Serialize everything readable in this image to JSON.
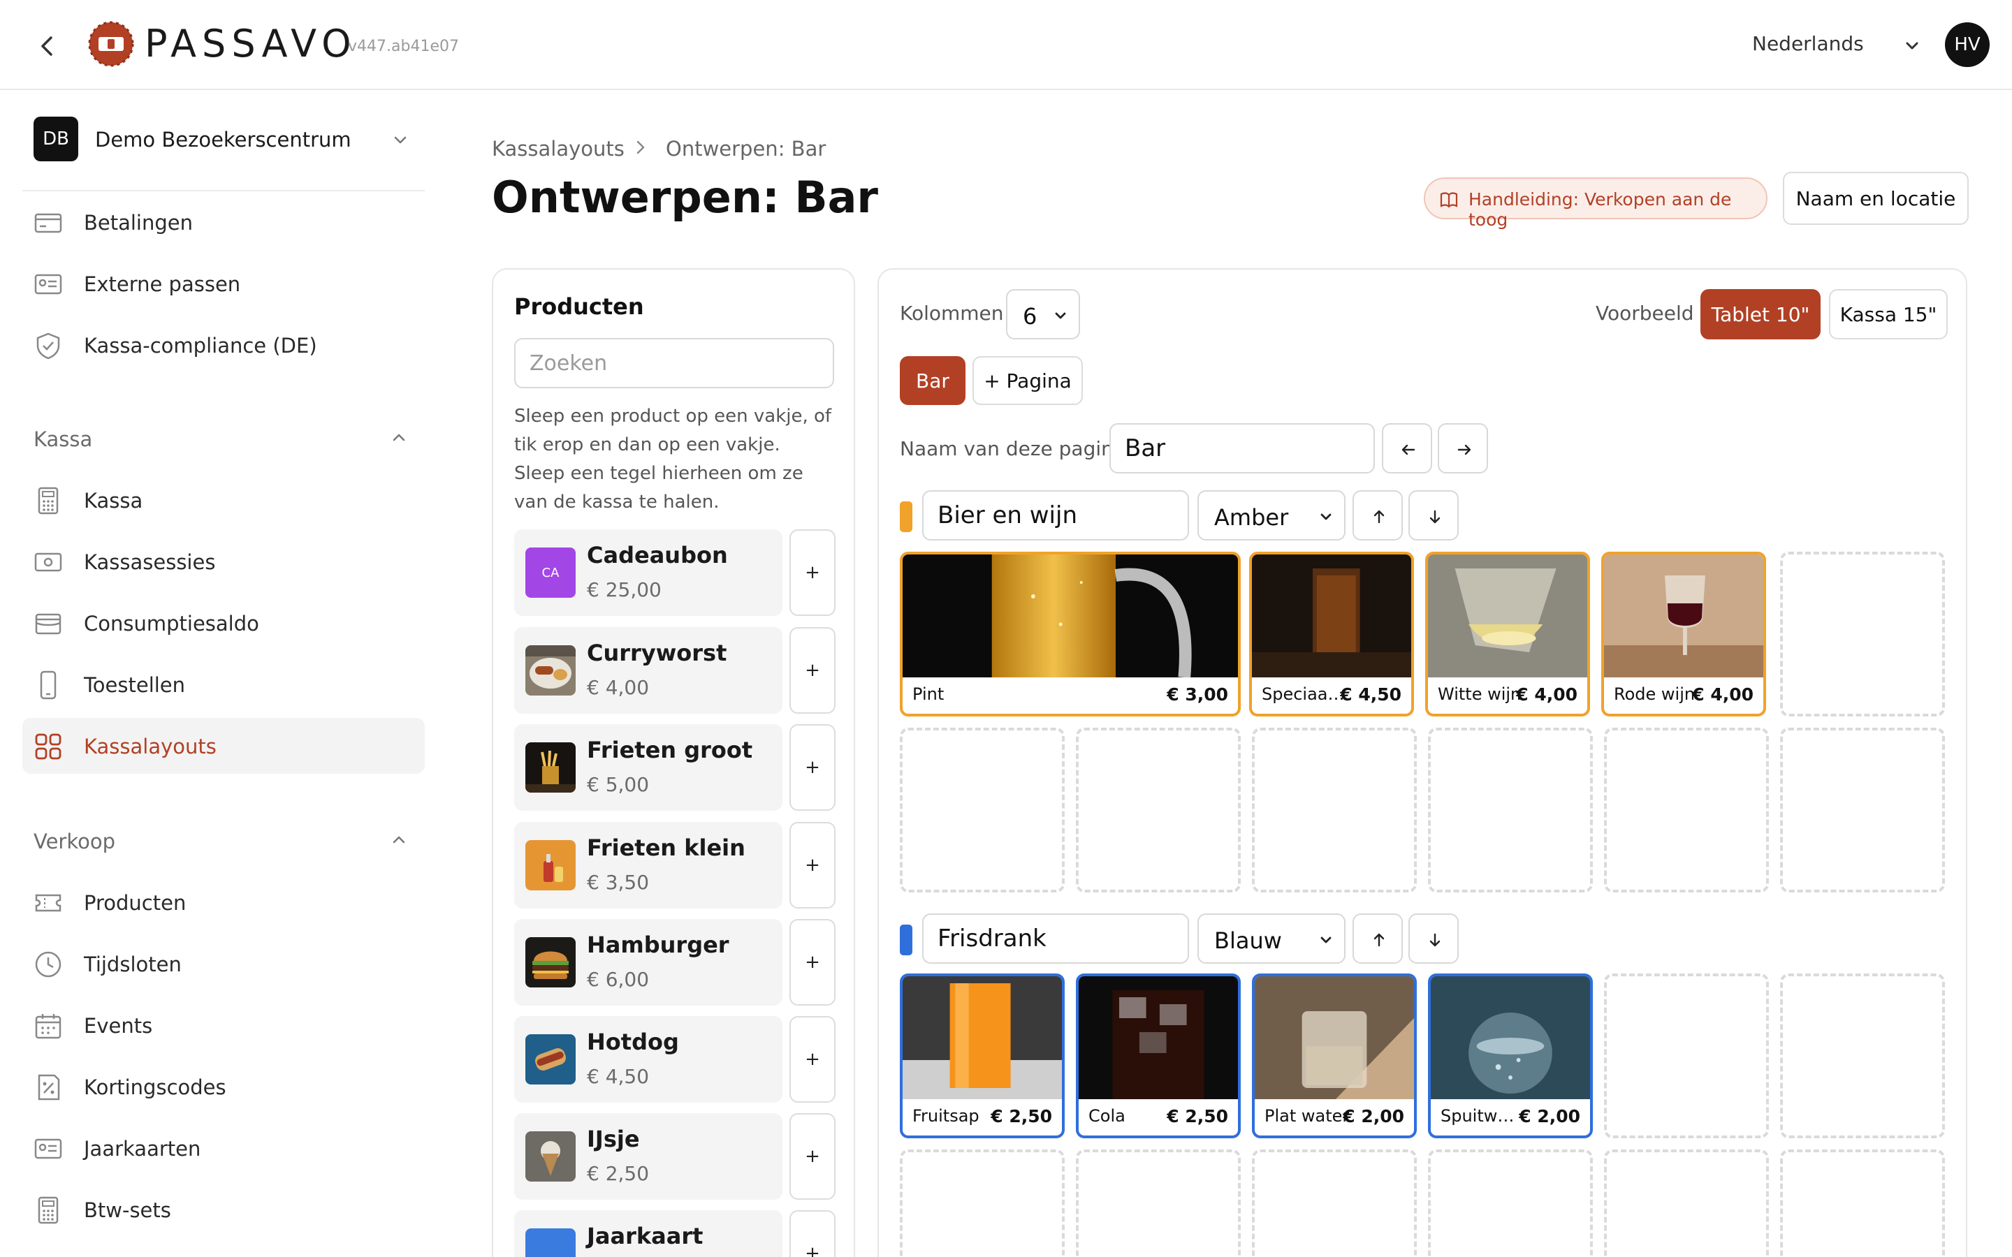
{
  "header": {
    "brand": "PASSAVO",
    "version": "v447.ab41e07",
    "language": "Nederlands",
    "user_initials": "HV"
  },
  "sidebar": {
    "org_initials": "DB",
    "org_name": "Demo Bezoekerscentrum",
    "top_items": [
      {
        "label": "Betalingen",
        "icon": "credit-card-icon"
      },
      {
        "label": "Externe passen",
        "icon": "id-card-icon"
      },
      {
        "label": "Kassa-compliance (DE)",
        "icon": "shield-check-icon"
      }
    ],
    "kassa": {
      "title": "Kassa",
      "items": [
        {
          "label": "Kassa",
          "icon": "calculator-icon"
        },
        {
          "label": "Kassasessies",
          "icon": "cash-icon"
        },
        {
          "label": "Consumptiesaldo",
          "icon": "wallet-icon"
        },
        {
          "label": "Toestellen",
          "icon": "phone-icon"
        },
        {
          "label": "Kassalayouts",
          "icon": "grid-icon",
          "active": true
        }
      ]
    },
    "verkoop": {
      "title": "Verkoop",
      "items": [
        {
          "label": "Producten",
          "icon": "ticket-icon"
        },
        {
          "label": "Tijdsloten",
          "icon": "clock-icon"
        },
        {
          "label": "Events",
          "icon": "calendar-icon"
        },
        {
          "label": "Kortingscodes",
          "icon": "percent-icon"
        },
        {
          "label": "Jaarkaarten",
          "icon": "id-card-icon"
        },
        {
          "label": "Btw-sets",
          "icon": "calculator-icon"
        }
      ]
    }
  },
  "breadcrumb": {
    "parent": "Kassalayouts",
    "current": "Ontwerpen: Bar"
  },
  "page": {
    "title": "Ontwerpen: Bar",
    "guide_label": "Handleiding: Verkopen aan de toog",
    "name_location_label": "Naam en locatie"
  },
  "products_panel": {
    "title": "Producten",
    "search_placeholder": "Zoeken",
    "help_text": "Sleep een product op een vakje, of tik erop en dan op een vakje. Sleep een tegel hierheen om ze van de kassa te halen.",
    "add_label": "+",
    "products": [
      {
        "name": "Cadeaubon",
        "price": "€ 25,00",
        "thumb": "CA"
      },
      {
        "name": "Curryworst",
        "price": "€ 4,00",
        "thumb": ""
      },
      {
        "name": "Frieten groot",
        "price": "€ 5,00",
        "thumb": ""
      },
      {
        "name": "Frieten klein",
        "price": "€ 3,50",
        "thumb": ""
      },
      {
        "name": "Hamburger",
        "price": "€ 6,00",
        "thumb": ""
      },
      {
        "name": "Hotdog",
        "price": "€ 4,50",
        "thumb": ""
      },
      {
        "name": "IJsje",
        "price": "€ 2,50",
        "thumb": ""
      },
      {
        "name": "Jaarkaart",
        "price": "",
        "thumb": "JA"
      }
    ]
  },
  "layout": {
    "columns_label": "Kolommen",
    "columns_value": "6",
    "preview_label": "Voorbeeld",
    "preview_options": [
      "Tablet 10\"",
      "Kassa 15\""
    ],
    "pages": [
      "Bar"
    ],
    "add_page_label": "+ Pagina",
    "page_name_label": "Naam van deze pagina",
    "page_name_value": "Bar",
    "groups": [
      {
        "name": "Bier en wijn",
        "color_name": "Amber",
        "color": "#f0a22a",
        "tiles": [
          {
            "name": "Pint",
            "price": "€ 3,00"
          },
          {
            "name": "Speciaa…",
            "price": "€ 4,50"
          },
          {
            "name": "Witte wijn",
            "price": "€ 4,00"
          },
          {
            "name": "Rode wijn",
            "price": "€ 4,00"
          }
        ]
      },
      {
        "name": "Frisdrank",
        "color_name": "Blauw",
        "color": "#2f6fdc",
        "tiles": [
          {
            "name": "Fruitsap",
            "price": "€ 2,50"
          },
          {
            "name": "Cola",
            "price": "€ 2,50"
          },
          {
            "name": "Plat water",
            "price": "€ 2,00"
          },
          {
            "name": "Spuitwa…",
            "price": "€ 2,00"
          }
        ]
      }
    ]
  },
  "colors": {
    "accent": "#b24025",
    "amber": "#f0a22a",
    "blue": "#2f6fdc"
  }
}
